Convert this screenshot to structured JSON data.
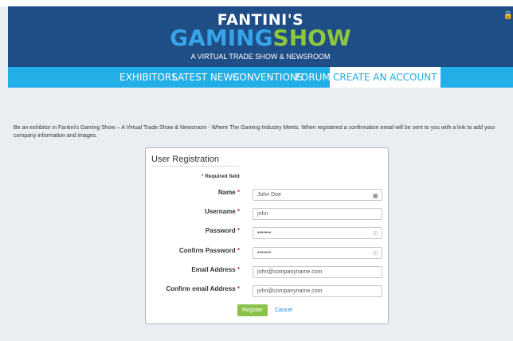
{
  "header": {
    "logo_line1": "FANTINI'S",
    "logo_gaming": "GAMING",
    "logo_show": "SHOW",
    "tagline": "A VIRTUAL TRADE SHOW & NEWSROOM",
    "bg_color": "#1f4d86"
  },
  "nav": {
    "items": [
      {
        "label": "EXHIBITORS"
      },
      {
        "label": "LATEST NEWS"
      },
      {
        "label": "CONVENTIONS"
      },
      {
        "label": "FORUM"
      },
      {
        "label": "CREATE AN ACCOUNT",
        "active": true
      }
    ],
    "bg_color": "#22aee6"
  },
  "intro": {
    "text": "Be an exhibitor in Fantini's Gaming Show – A Virtual Trade Show & Newsroom - Where The Gaming Industry Meets. When registered a confirmation email will be sent to you with a link to add your company information and images."
  },
  "form": {
    "title": "User Registration",
    "required_note": "Required field",
    "required_mark": "*",
    "fields": [
      {
        "label": "Name",
        "value": "John Doe",
        "icon": "contact-card-icon"
      },
      {
        "label": "Username",
        "value": "john"
      },
      {
        "label": "Password",
        "value": "•••••••",
        "icon": "key-icon"
      },
      {
        "label": "Confirm Password",
        "value": "•••••••",
        "icon": "key-icon"
      },
      {
        "label": "Email Address",
        "value": "john@companyname.com"
      },
      {
        "label": "Confirm email Address",
        "value": "john@companyname.com"
      }
    ],
    "register_label": "Register",
    "cancel_label": "Cancel",
    "accent_color": "#8bc34a"
  }
}
